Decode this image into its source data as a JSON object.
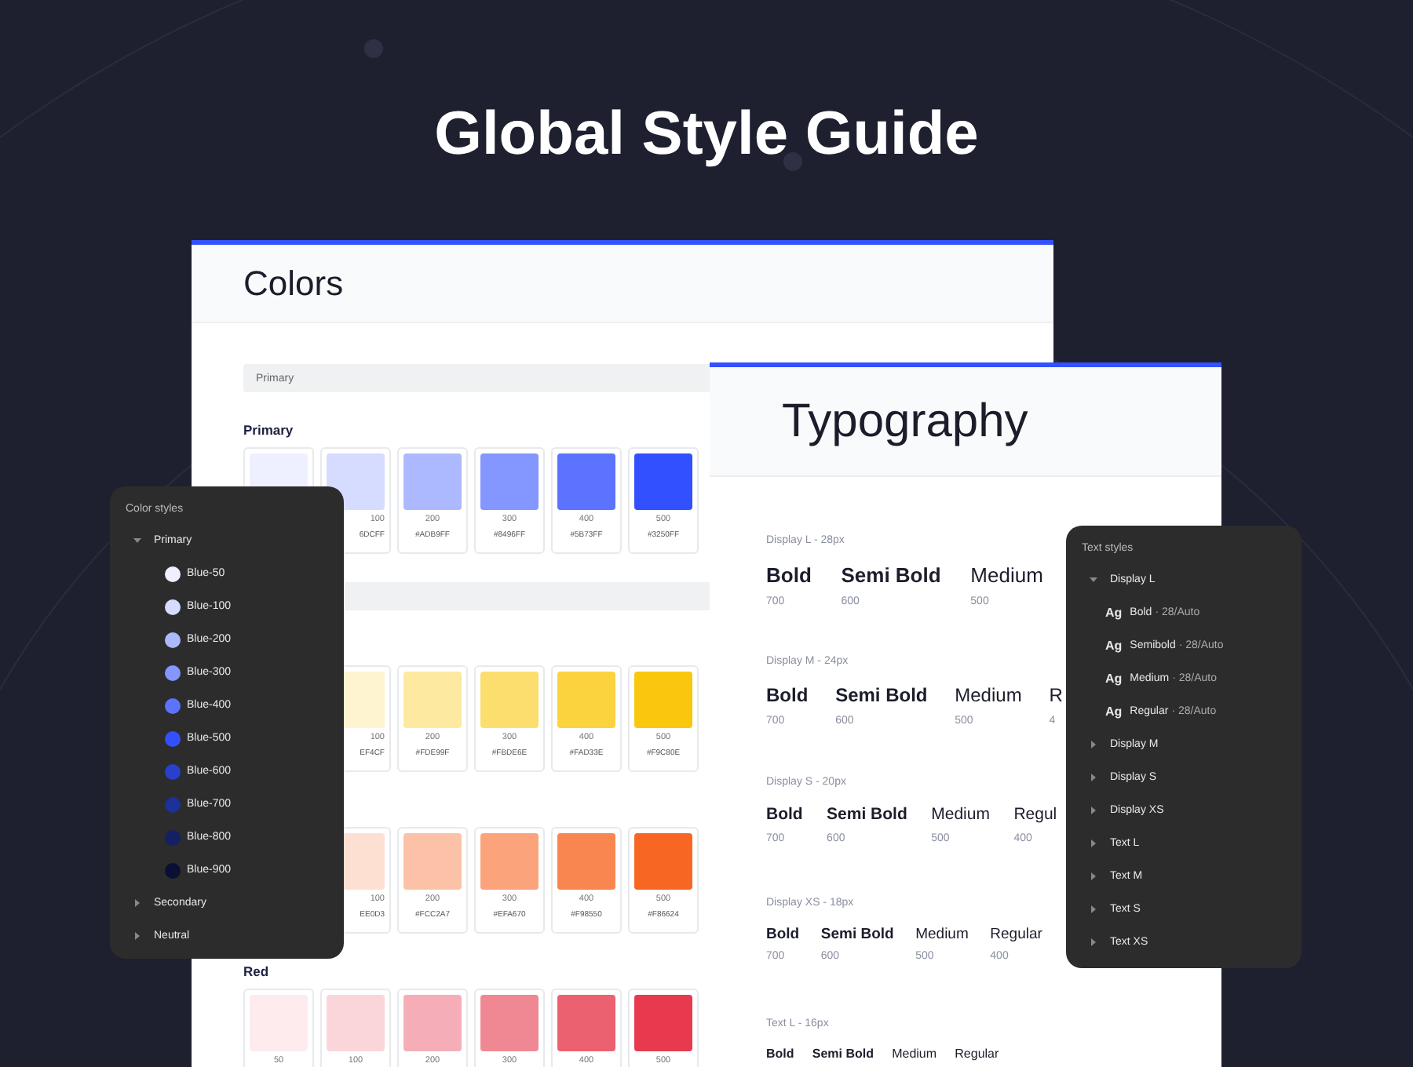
{
  "title": "Global Style Guide",
  "colors_panel": {
    "title": "Colors",
    "sections": [
      {
        "label": "Primary",
        "groups": [
          {
            "heading": "Primary",
            "swatches": [
              {
                "color": "#EEF0FF"
              },
              {
                "color": "#D6DCFF",
                "label": "100",
                "hex": "6DCFF"
              },
              {
                "color": "#ADB9FF",
                "label": "200",
                "hex": "#ADB9FF"
              },
              {
                "color": "#8496FF",
                "label": "300",
                "hex": "#8496FF"
              },
              {
                "color": "#5B73FF",
                "label": "400",
                "hex": "#5B73FF"
              },
              {
                "color": "#3250FF",
                "label": "500",
                "hex": "#3250FF"
              }
            ]
          }
        ]
      },
      {
        "groups": [
          {
            "swatches": [
              {
                "color": "#FEF4CF",
                "label": "100",
                "hex": "EF4CF"
              },
              {
                "color": "#FDE99F",
                "label": "200",
                "hex": "#FDE99F"
              },
              {
                "color": "#FBDE6E",
                "label": "300",
                "hex": "#FBDE6E"
              },
              {
                "color": "#FAD33E",
                "label": "400",
                "hex": "#FAD33E"
              },
              {
                "color": "#F9C80E",
                "label": "500",
                "hex": "#F9C80E"
              }
            ]
          },
          {
            "swatches": [
              {
                "color": "#FEE0D3",
                "label": "100",
                "hex": "EE0D3"
              },
              {
                "color": "#FCC2A7",
                "label": "200",
                "hex": "#FCC2A7"
              },
              {
                "color": "#FBA47B",
                "label": "300",
                "hex": "#EFA670"
              },
              {
                "color": "#F98550",
                "label": "400",
                "hex": "#F98550"
              },
              {
                "color": "#F86624",
                "label": "500",
                "hex": "#F86624"
              }
            ]
          },
          {
            "heading": "Red",
            "swatches": [
              {
                "color": "#FDEBED",
                "label": "50"
              },
              {
                "color": "#FAD5DA",
                "label": "100"
              },
              {
                "color": "#F5AEB7",
                "label": "200"
              },
              {
                "color": "#F08893",
                "label": "300"
              },
              {
                "color": "#EC6170",
                "label": "400"
              },
              {
                "color": "#E73A4F",
                "label": "500"
              }
            ]
          }
        ]
      }
    ]
  },
  "color_styles": {
    "title": "Color styles",
    "items": [
      {
        "label": "Primary",
        "expanded": true,
        "children": [
          {
            "label": "Blue-50",
            "color": "#EEF0FF"
          },
          {
            "label": "Blue-100",
            "color": "#D6DCFF"
          },
          {
            "label": "Blue-200",
            "color": "#ADB9FF"
          },
          {
            "label": "Blue-300",
            "color": "#8496FF"
          },
          {
            "label": "Blue-400",
            "color": "#5B73FF"
          },
          {
            "label": "Blue-500",
            "color": "#3250FF"
          },
          {
            "label": "Blue-600",
            "color": "#2840CC"
          },
          {
            "label": "Blue-700",
            "color": "#1E3099"
          },
          {
            "label": "Blue-800",
            "color": "#142066"
          },
          {
            "label": "Blue-900",
            "color": "#0A1033"
          }
        ]
      },
      {
        "label": "Secondary",
        "expanded": false
      },
      {
        "label": "Neutral",
        "expanded": false
      }
    ]
  },
  "typography_panel": {
    "title": "Typography",
    "sections": [
      {
        "label": "Display L - 28px",
        "samples": [
          {
            "name": "Bold",
            "weight": "700"
          },
          {
            "name": "Semi Bold",
            "weight": "600"
          },
          {
            "name": "Medium",
            "weight": "500"
          }
        ]
      },
      {
        "label": "Display M - 24px",
        "samples": [
          {
            "name": "Bold",
            "weight": "700"
          },
          {
            "name": "Semi Bold",
            "weight": "600"
          },
          {
            "name": "Medium",
            "weight": "500"
          },
          {
            "name": "R",
            "weight": "4"
          }
        ]
      },
      {
        "label": "Display S - 20px",
        "samples": [
          {
            "name": "Bold",
            "weight": "700"
          },
          {
            "name": "Semi Bold",
            "weight": "600"
          },
          {
            "name": "Medium",
            "weight": "500"
          },
          {
            "name": "Regul",
            "weight": "400"
          }
        ]
      },
      {
        "label": "Display XS - 18px",
        "samples": [
          {
            "name": "Bold",
            "weight": "700"
          },
          {
            "name": "Semi Bold",
            "weight": "600"
          },
          {
            "name": "Medium",
            "weight": "500"
          },
          {
            "name": "Regular",
            "weight": "400"
          }
        ]
      },
      {
        "label": "Text L - 16px",
        "samples": [
          {
            "name": "Bold"
          },
          {
            "name": "Semi Bold"
          },
          {
            "name": "Medium"
          },
          {
            "name": "Regular"
          }
        ]
      }
    ]
  },
  "text_styles": {
    "title": "Text styles",
    "items": [
      {
        "label": "Display L",
        "expanded": true,
        "children": [
          {
            "glyph": "Ag",
            "name": "Bold",
            "spec": "· 28/Auto"
          },
          {
            "glyph": "Ag",
            "name": "Semibold",
            "spec": "· 28/Auto"
          },
          {
            "glyph": "Ag",
            "name": "Medium",
            "spec": "· 28/Auto"
          },
          {
            "glyph": "Ag",
            "name": "Regular",
            "spec": "· 28/Auto"
          }
        ]
      },
      {
        "label": "Display M",
        "expanded": false
      },
      {
        "label": "Display S",
        "expanded": false
      },
      {
        "label": "Display XS",
        "expanded": false
      },
      {
        "label": "Text L",
        "expanded": false
      },
      {
        "label": "Text M",
        "expanded": false
      },
      {
        "label": "Text S",
        "expanded": false
      },
      {
        "label": "Text XS",
        "expanded": false
      }
    ]
  }
}
